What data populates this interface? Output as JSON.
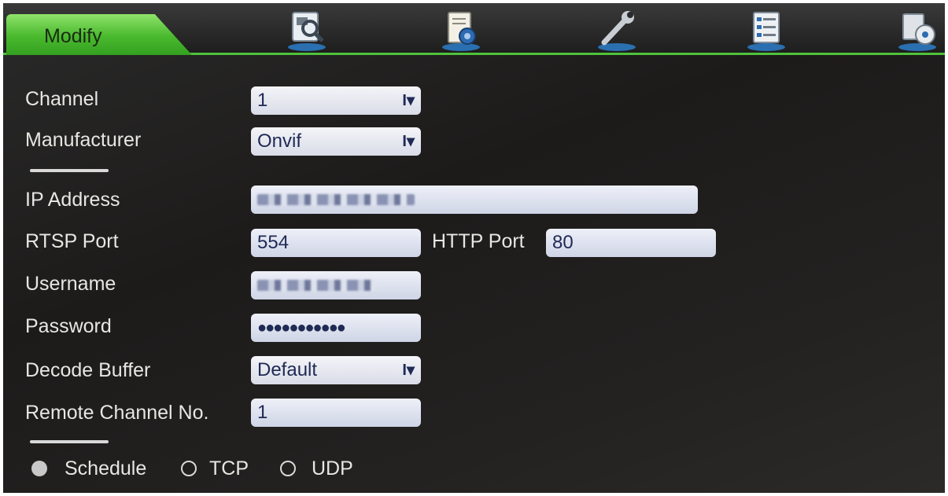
{
  "header": {
    "active_tab": "Modify",
    "icons": [
      "search-camera-icon",
      "document-settings-icon",
      "wrench-tools-icon",
      "list-menu-icon",
      "disk-settings-icon"
    ],
    "accent_color": "#4fc23a"
  },
  "form": {
    "channel": {
      "label": "Channel",
      "value": "1"
    },
    "manufacturer": {
      "label": "Manufacturer",
      "value": "Onvif"
    },
    "ip_address": {
      "label": "IP Address",
      "value": ""
    },
    "rtsp_port": {
      "label": "RTSP Port",
      "value": "554"
    },
    "http_port": {
      "label": "HTTP Port",
      "value": "80"
    },
    "username": {
      "label": "Username",
      "value": ""
    },
    "password": {
      "label": "Password",
      "value": "●●●●●●●●●●●"
    },
    "decode_buffer": {
      "label": "Decode Buffer",
      "value": "Default"
    },
    "remote_channel": {
      "label": "Remote Channel No.",
      "value": "1"
    },
    "dropdown_caret": "I▾"
  },
  "protocol": {
    "options": [
      "Schedule",
      "TCP",
      "UDP"
    ],
    "selected": "Schedule"
  }
}
